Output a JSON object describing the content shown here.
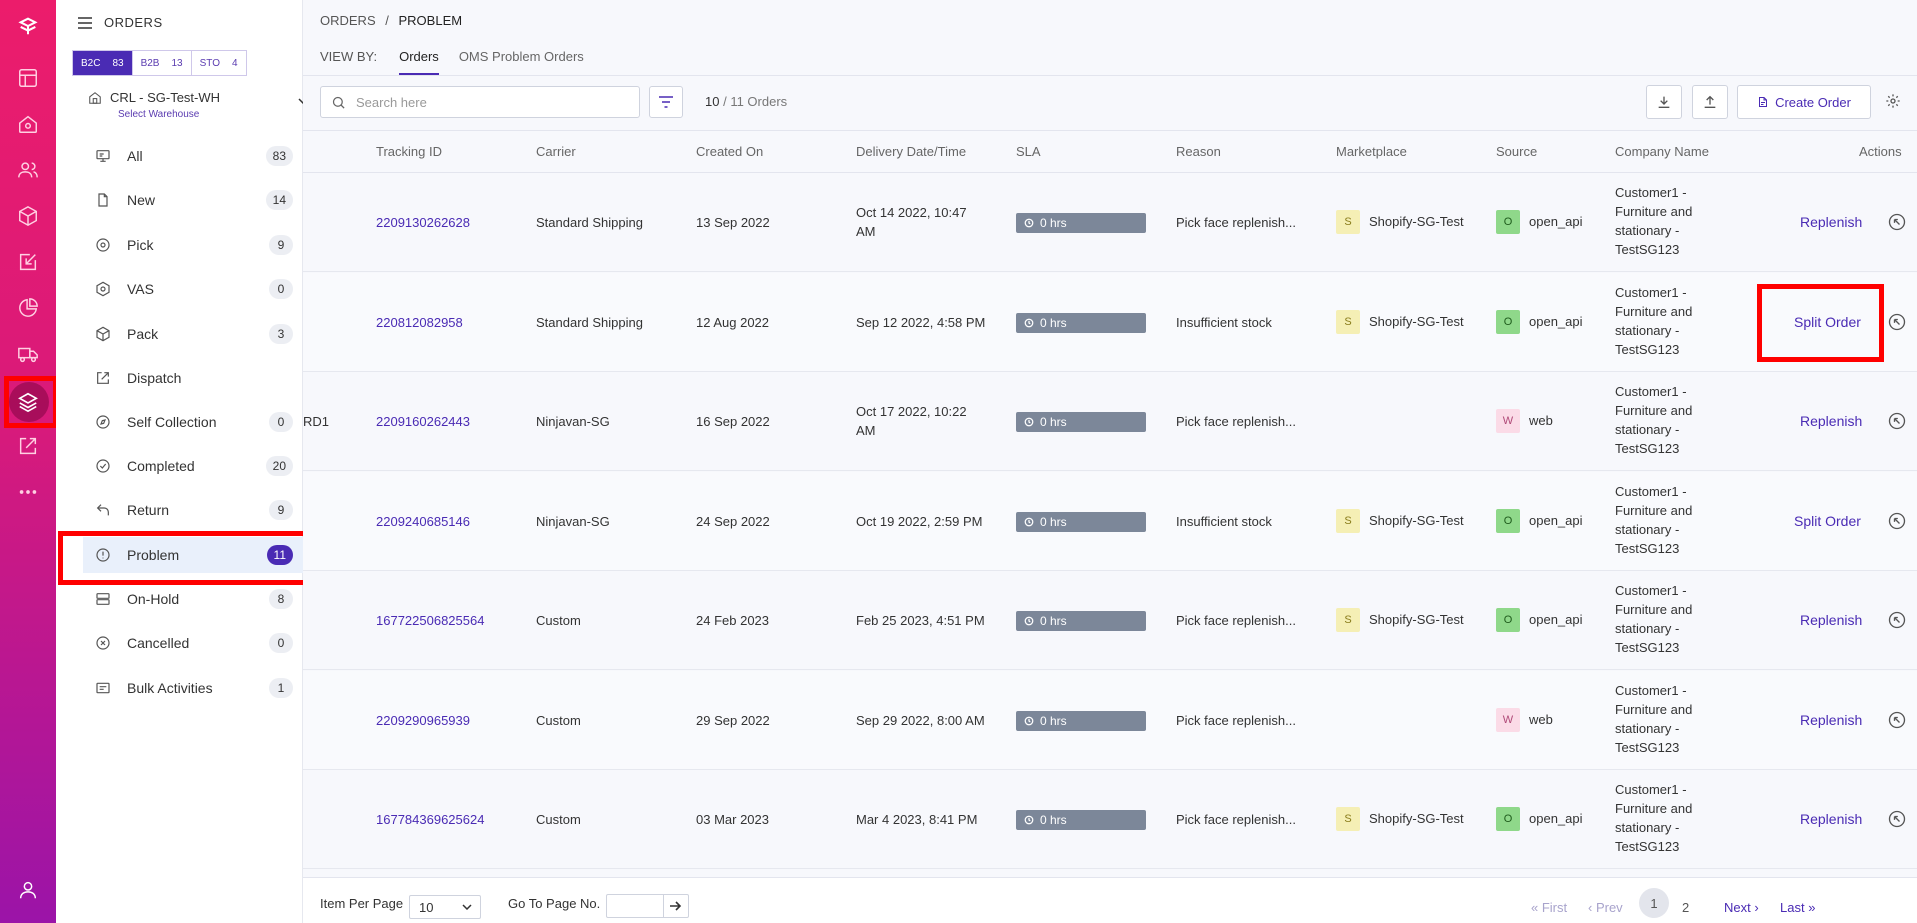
{
  "rail": {
    "icons": [
      "logo-icon",
      "dashboard-icon",
      "home-icon",
      "users-icon",
      "box-icon",
      "inbound-icon",
      "analytics-icon",
      "truck-icon",
      "layers-icon",
      "export-icon",
      "more-icon",
      "profile-icon"
    ]
  },
  "sidebar": {
    "title": "ORDERS",
    "segments": [
      {
        "label": "B2C",
        "count": "83"
      },
      {
        "label": "B2B",
        "count": "13"
      },
      {
        "label": "STO",
        "count": "4"
      }
    ],
    "warehouse": {
      "name": "CRL - SG-Test-WH",
      "sub": "Select Warehouse"
    },
    "items": [
      {
        "label": "All",
        "count": "83"
      },
      {
        "label": "New",
        "count": "14"
      },
      {
        "label": "Pick",
        "count": "9"
      },
      {
        "label": "VAS",
        "count": "0"
      },
      {
        "label": "Pack",
        "count": "3"
      },
      {
        "label": "Dispatch",
        "count": ""
      },
      {
        "label": "Self Collection",
        "count": "0"
      },
      {
        "label": "Completed",
        "count": "20"
      },
      {
        "label": "Return",
        "count": "9"
      },
      {
        "label": "Problem",
        "count": "11"
      },
      {
        "label": "On-Hold",
        "count": "8"
      },
      {
        "label": "Cancelled",
        "count": "0"
      },
      {
        "label": "Bulk Activities",
        "count": "1"
      }
    ]
  },
  "header": {
    "crumb_root": "ORDERS",
    "crumb_sep": "/",
    "crumb_current": "PROBLEM",
    "viewby_label": "VIEW BY:",
    "tab_orders": "Orders",
    "tab_oms": "OMS Problem Orders"
  },
  "toolbar": {
    "search_placeholder": "Search here",
    "count_shown": "10",
    "count_total": "/ 11 Orders",
    "create_label": "Create Order"
  },
  "table": {
    "headers": [
      "Tracking ID",
      "Carrier",
      "Created On",
      "Delivery Date/Time",
      "SLA",
      "Reason",
      "Marketplace",
      "Source",
      "Company Name",
      "Actions"
    ],
    "rows": [
      {
        "prefix": "",
        "tracking": "2209130262628",
        "carrier": "Standard Shipping",
        "created": "13 Sep 2022",
        "delivery1": "Oct 14 2022, 10:47",
        "delivery2": "AM",
        "sla": "0 hrs",
        "reason": "Pick face replenish...",
        "mk_letter": "S",
        "marketplace": "Shopify-SG-Test",
        "src_letter": "O",
        "source": "open_api",
        "company1": "Customer1 -",
        "company2": "Furniture and",
        "company3": "stationary -",
        "company4": "TestSG123",
        "action": "Replenish"
      },
      {
        "prefix": "",
        "tracking": "220812082958",
        "carrier": "Standard Shipping",
        "created": "12 Aug 2022",
        "delivery1": "Sep 12 2022, 4:58 PM",
        "delivery2": "",
        "sla": "0 hrs",
        "reason": "Insufficient stock",
        "mk_letter": "S",
        "marketplace": "Shopify-SG-Test",
        "src_letter": "O",
        "source": "open_api",
        "company1": "Customer1 -",
        "company2": "Furniture and",
        "company3": "stationary -",
        "company4": "TestSG123",
        "action": "Split Order"
      },
      {
        "prefix": "RD1",
        "tracking": "2209160262443",
        "carrier": "Ninjavan-SG",
        "created": "16 Sep 2022",
        "delivery1": "Oct 17 2022, 10:22",
        "delivery2": "AM",
        "sla": "0 hrs",
        "reason": "Pick face replenish...",
        "mk_letter": "",
        "marketplace": "",
        "src_letter": "W",
        "source": "web",
        "company1": "Customer1 -",
        "company2": "Furniture and",
        "company3": "stationary -",
        "company4": "TestSG123",
        "action": "Replenish"
      },
      {
        "prefix": "",
        "tracking": "2209240685146",
        "carrier": "Ninjavan-SG",
        "created": "24 Sep 2022",
        "delivery1": "Oct 19 2022, 2:59 PM",
        "delivery2": "",
        "sla": "0 hrs",
        "reason": "Insufficient stock",
        "mk_letter": "S",
        "marketplace": "Shopify-SG-Test",
        "src_letter": "O",
        "source": "open_api",
        "company1": "Customer1 -",
        "company2": "Furniture and",
        "company3": "stationary -",
        "company4": "TestSG123",
        "action": "Split Order"
      },
      {
        "prefix": "",
        "tracking": "167722506825564",
        "carrier": "Custom",
        "created": "24 Feb 2023",
        "delivery1": "Feb 25 2023, 4:51 PM",
        "delivery2": "",
        "sla": "0 hrs",
        "reason": "Pick face replenish...",
        "mk_letter": "S",
        "marketplace": "Shopify-SG-Test",
        "src_letter": "O",
        "source": "open_api",
        "company1": "Customer1 -",
        "company2": "Furniture and",
        "company3": "stationary -",
        "company4": "TestSG123",
        "action": "Replenish"
      },
      {
        "prefix": "",
        "tracking": "2209290965939",
        "carrier": "Custom",
        "created": "29 Sep 2022",
        "delivery1": "Sep 29 2022, 8:00 AM",
        "delivery2": "",
        "sla": "0 hrs",
        "reason": "Pick face replenish...",
        "mk_letter": "",
        "marketplace": "",
        "src_letter": "W",
        "source": "web",
        "company1": "Customer1 -",
        "company2": "Furniture and",
        "company3": "stationary -",
        "company4": "TestSG123",
        "action": "Replenish"
      },
      {
        "prefix": "",
        "tracking": "167784369625624",
        "carrier": "Custom",
        "created": "03 Mar 2023",
        "delivery1": "Mar 4 2023, 8:41 PM",
        "delivery2": "",
        "sla": "0 hrs",
        "reason": "Pick face replenish...",
        "mk_letter": "S",
        "marketplace": "Shopify-SG-Test",
        "src_letter": "O",
        "source": "open_api",
        "company1": "Customer1 -",
        "company2": "Furniture and",
        "company3": "stationary -",
        "company4": "TestSG123",
        "action": "Replenish"
      }
    ]
  },
  "footer": {
    "per_page_label": "Item Per Page",
    "per_page_value": "10",
    "goto_label": "Go To Page No.",
    "first": "First",
    "prev": "Prev",
    "page1": "1",
    "page2": "2",
    "next": "Next",
    "last": "Last"
  },
  "colors": {
    "accent": "#4a2bb4",
    "rail_top": "#ec1c6b",
    "rail_bottom": "#9b14a8",
    "highlight": "#ff0000",
    "sla": "#7c8799"
  }
}
